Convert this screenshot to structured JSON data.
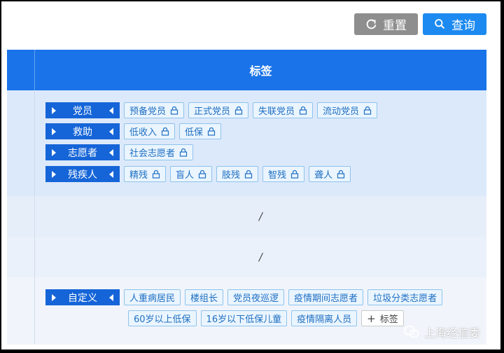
{
  "toolbar": {
    "reset_label": "重置",
    "query_label": "查询"
  },
  "table": {
    "header_title": "标签",
    "empty_placeholder": "/"
  },
  "categories": [
    {
      "label": "党员",
      "tags": [
        "预备党员",
        "正式党员",
        "失联党员",
        "流动党员"
      ]
    },
    {
      "label": "救助",
      "tags": [
        "低收入",
        "低保"
      ]
    },
    {
      "label": "志愿者",
      "tags": [
        "社会志愿者"
      ]
    },
    {
      "label": "残疾人",
      "tags": [
        "精残",
        "盲人",
        "肢残",
        "智残",
        "聋人"
      ]
    }
  ],
  "custom": {
    "label": "自定义",
    "tags_row1": [
      "人重病居民",
      "楼组长",
      "党员夜巡逻",
      "疫情期间志愿者",
      "垃圾分类志愿者"
    ],
    "tags_row2": [
      "60岁以上低保",
      "16岁以下低保儿童",
      "疫情隔离人员"
    ],
    "add_label": "标签"
  },
  "watermark": "上海经信委",
  "colors": {
    "primary": "#1a73e8",
    "category": "#1565d8",
    "tag_text": "#1f6fc2",
    "reset_button": "#8e8e8e"
  }
}
